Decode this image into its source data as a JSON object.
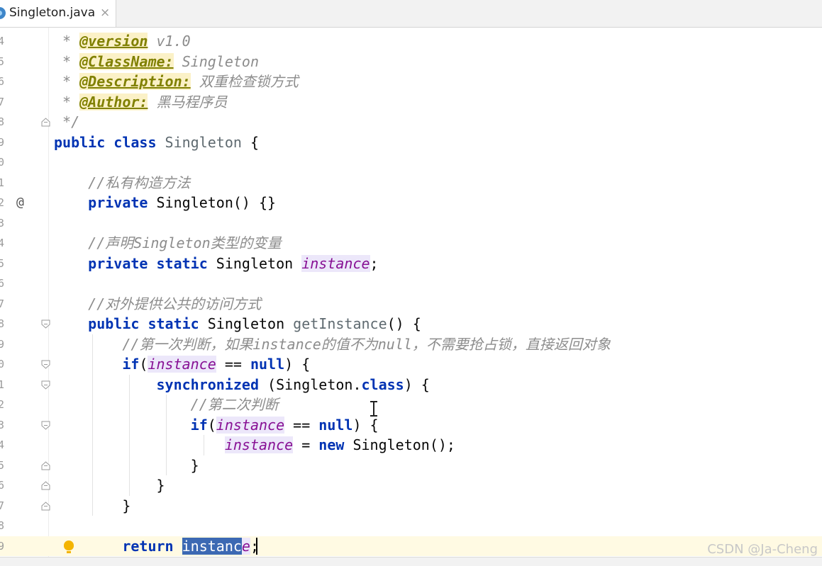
{
  "tab": {
    "title": "Singleton.java",
    "close": "×",
    "icon": "java-class-icon"
  },
  "lines": [
    {
      "num": "4",
      "parts": [
        [
          "doc",
          " * "
        ],
        [
          "tag",
          "@version"
        ],
        [
          "doc",
          " v1.0"
        ]
      ]
    },
    {
      "num": "5",
      "parts": [
        [
          "doc",
          " * "
        ],
        [
          "tag",
          "@ClassName:"
        ],
        [
          "doc",
          " Singleton"
        ]
      ]
    },
    {
      "num": "6",
      "parts": [
        [
          "doc",
          " * "
        ],
        [
          "tag",
          "@Description:"
        ],
        [
          "doc",
          " 双重检查锁方式"
        ]
      ]
    },
    {
      "num": "7",
      "parts": [
        [
          "doc",
          " * "
        ],
        [
          "tag",
          "@Author:"
        ],
        [
          "doc",
          " 黑马程序员"
        ]
      ]
    },
    {
      "num": "8",
      "parts": [
        [
          "doc",
          " */"
        ]
      ]
    },
    {
      "num": "9",
      "parts": [
        [
          "kw",
          "public class "
        ],
        [
          "cls",
          "Singleton"
        ],
        [
          "p",
          " {"
        ]
      ]
    },
    {
      "num": "0",
      "parts": []
    },
    {
      "num": "1",
      "parts": [
        [
          "p",
          "    "
        ],
        [
          "cmt",
          "//私有构造方法"
        ]
      ]
    },
    {
      "num": "2",
      "parts": [
        [
          "p",
          "    "
        ],
        [
          "kw",
          "private "
        ],
        [
          "p",
          "Singleton() {}"
        ]
      ]
    },
    {
      "num": "3",
      "parts": []
    },
    {
      "num": "4",
      "parts": [
        [
          "p",
          "    "
        ],
        [
          "cmt",
          "//声明Singleton类型的变量"
        ]
      ]
    },
    {
      "num": "5",
      "parts": [
        [
          "p",
          "    "
        ],
        [
          "kw",
          "private static "
        ],
        [
          "p",
          "Singleton "
        ],
        [
          "fld",
          "instance"
        ],
        [
          "p",
          ";"
        ]
      ]
    },
    {
      "num": "6",
      "parts": []
    },
    {
      "num": "7",
      "parts": [
        [
          "p",
          "    "
        ],
        [
          "cmt",
          "//对外提供公共的访问方式"
        ]
      ]
    },
    {
      "num": "8",
      "parts": [
        [
          "p",
          "    "
        ],
        [
          "kw",
          "public static "
        ],
        [
          "p",
          "Singleton "
        ],
        [
          "cls",
          "getInstance"
        ],
        [
          "p",
          "() {"
        ]
      ]
    },
    {
      "num": "9",
      "parts": [
        [
          "p",
          "        "
        ],
        [
          "cmt",
          "//第一次判断，如果instance的值不为null，不需要抢占锁，直接返回对象"
        ]
      ]
    },
    {
      "num": "0",
      "parts": [
        [
          "p",
          "        "
        ],
        [
          "kw",
          "if"
        ],
        [
          "p",
          "("
        ],
        [
          "fld",
          "instance"
        ],
        [
          "p",
          " == "
        ],
        [
          "kw",
          "null"
        ],
        [
          "p",
          ") {"
        ]
      ]
    },
    {
      "num": "1",
      "parts": [
        [
          "p",
          "            "
        ],
        [
          "kw",
          "synchronized "
        ],
        [
          "p",
          "(Singleton."
        ],
        [
          "kw",
          "class"
        ],
        [
          "p",
          ") {"
        ]
      ]
    },
    {
      "num": "2",
      "parts": [
        [
          "p",
          "                "
        ],
        [
          "cmt",
          "//第二次判断"
        ]
      ]
    },
    {
      "num": "3",
      "parts": [
        [
          "p",
          "                "
        ],
        [
          "kw",
          "if"
        ],
        [
          "p",
          "("
        ],
        [
          "fld",
          "instance"
        ],
        [
          "p",
          " == "
        ],
        [
          "kw",
          "null"
        ],
        [
          "p",
          ") {"
        ]
      ]
    },
    {
      "num": "4",
      "parts": [
        [
          "p",
          "                    "
        ],
        [
          "fld",
          "instance"
        ],
        [
          "p",
          " = "
        ],
        [
          "kw",
          "new "
        ],
        [
          "p",
          "Singleton();"
        ]
      ]
    },
    {
      "num": "5",
      "parts": [
        [
          "p",
          "                }"
        ]
      ]
    },
    {
      "num": "6",
      "parts": [
        [
          "p",
          "            }"
        ]
      ]
    },
    {
      "num": "7",
      "parts": [
        [
          "p",
          "        }"
        ]
      ]
    },
    {
      "num": "8",
      "parts": []
    },
    {
      "num": "9",
      "parts": [
        [
          "p",
          "        "
        ],
        [
          "kw",
          "return "
        ],
        [
          "sel",
          "instanc"
        ],
        [
          "fld",
          "e"
        ],
        [
          "p",
          ";"
        ]
      ]
    }
  ],
  "gutter_marks": {
    "fold_icon": "fold-icon",
    "override_icon": "@",
    "bulb_icon": "lightbulb-icon"
  },
  "watermark": "CSDN @Ja-Cheng"
}
